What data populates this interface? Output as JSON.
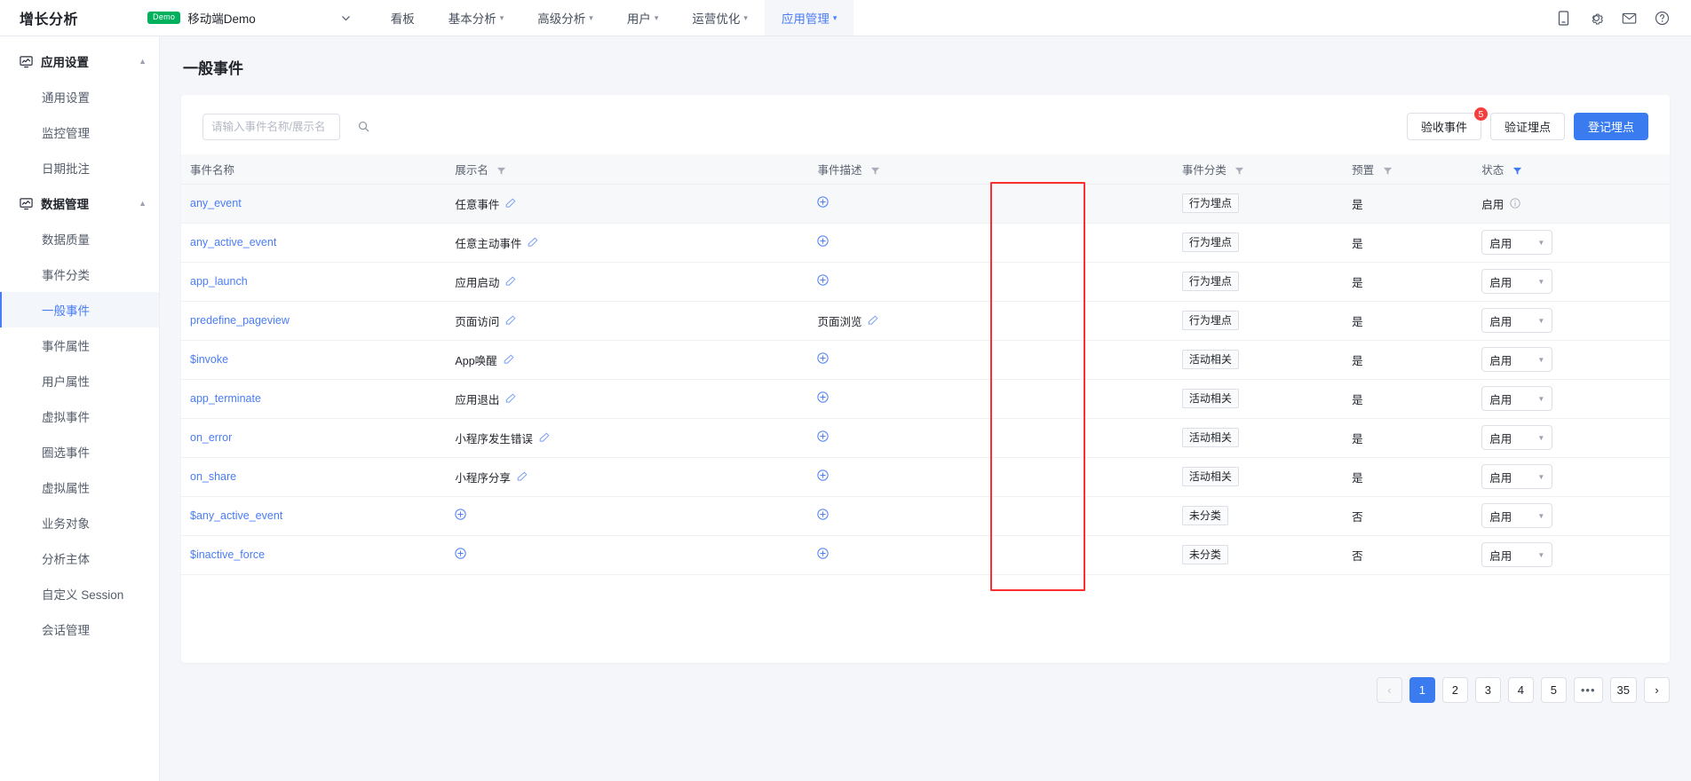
{
  "topbar": {
    "brand": "增长分析",
    "project": {
      "badge": "Demo",
      "name": "移动端Demo"
    },
    "nav": [
      {
        "label": "看板",
        "caret": false,
        "active": false
      },
      {
        "label": "基本分析",
        "caret": true,
        "active": false
      },
      {
        "label": "高级分析",
        "caret": true,
        "active": false
      },
      {
        "label": "用户",
        "caret": true,
        "active": false
      },
      {
        "label": "运营优化",
        "caret": true,
        "active": false
      },
      {
        "label": "应用管理",
        "caret": true,
        "active": true
      }
    ],
    "icons": [
      "mobile-icon",
      "gear-icon",
      "mail-icon",
      "help-icon"
    ]
  },
  "sidebar": {
    "groups": [
      {
        "label": "应用设置",
        "icon": "monitor-chart-icon",
        "expanded": true,
        "items": [
          {
            "label": "通用设置",
            "active": false
          },
          {
            "label": "监控管理",
            "active": false
          },
          {
            "label": "日期批注",
            "active": false
          }
        ]
      },
      {
        "label": "数据管理",
        "icon": "monitor-chart-icon",
        "expanded": true,
        "items": [
          {
            "label": "数据质量",
            "active": false
          },
          {
            "label": "事件分类",
            "active": false
          },
          {
            "label": "一般事件",
            "active": true
          },
          {
            "label": "事件属性",
            "active": false
          },
          {
            "label": "用户属性",
            "active": false
          },
          {
            "label": "虚拟事件",
            "active": false
          },
          {
            "label": "圈选事件",
            "active": false
          },
          {
            "label": "虚拟属性",
            "active": false
          },
          {
            "label": "业务对象",
            "active": false
          },
          {
            "label": "分析主体",
            "active": false
          },
          {
            "label": "自定义 Session",
            "active": false
          },
          {
            "label": "会话管理",
            "active": false
          }
        ]
      }
    ]
  },
  "page": {
    "title": "一般事件"
  },
  "search": {
    "value": "",
    "placeholder": "请输入事件名称/展示名"
  },
  "toolbar": {
    "accept_events_label": "验收事件",
    "accept_events_badge": "5",
    "verify_label": "验证埋点",
    "register_label": "登记埋点"
  },
  "table": {
    "columns": [
      {
        "label": "事件名称",
        "filter": false,
        "filter_active": false
      },
      {
        "label": "展示名",
        "filter": true,
        "filter_active": false
      },
      {
        "label": "事件描述",
        "filter": true,
        "filter_active": false
      },
      {
        "label": "事件分类",
        "filter": true,
        "filter_active": false
      },
      {
        "label": "预置",
        "filter": true,
        "filter_active": false
      },
      {
        "label": "状态",
        "filter": true,
        "filter_active": true
      }
    ],
    "rows": [
      {
        "name": "any_event",
        "display": "任意事件",
        "display_add": false,
        "desc": "",
        "desc_add": true,
        "category": "行为埋点",
        "preset": "是",
        "status": "启用",
        "status_is_select": false,
        "hovered": true
      },
      {
        "name": "any_active_event",
        "display": "任意主动事件",
        "display_add": false,
        "desc": "",
        "desc_add": true,
        "category": "行为埋点",
        "preset": "是",
        "status": "启用",
        "status_is_select": true,
        "hovered": false
      },
      {
        "name": "app_launch",
        "display": "应用启动",
        "display_add": false,
        "desc": "",
        "desc_add": true,
        "category": "行为埋点",
        "preset": "是",
        "status": "启用",
        "status_is_select": true,
        "hovered": false
      },
      {
        "name": "predefine_pageview",
        "display": "页面访问",
        "display_add": false,
        "desc": "页面浏览",
        "desc_add": false,
        "category": "行为埋点",
        "preset": "是",
        "status": "启用",
        "status_is_select": true,
        "hovered": false
      },
      {
        "name": "$invoke",
        "display": "App唤醒",
        "display_add": false,
        "desc": "",
        "desc_add": true,
        "category": "活动相关",
        "preset": "是",
        "status": "启用",
        "status_is_select": true,
        "hovered": false
      },
      {
        "name": "app_terminate",
        "display": "应用退出",
        "display_add": false,
        "desc": "",
        "desc_add": true,
        "category": "活动相关",
        "preset": "是",
        "status": "启用",
        "status_is_select": true,
        "hovered": false
      },
      {
        "name": "on_error",
        "display": "小程序发生错误",
        "display_add": false,
        "desc": "",
        "desc_add": true,
        "category": "活动相关",
        "preset": "是",
        "status": "启用",
        "status_is_select": true,
        "hovered": false
      },
      {
        "name": "on_share",
        "display": "小程序分享",
        "display_add": false,
        "desc": "",
        "desc_add": true,
        "category": "活动相关",
        "preset": "是",
        "status": "启用",
        "status_is_select": true,
        "hovered": false
      },
      {
        "name": "$any_active_event",
        "display": "",
        "display_add": true,
        "desc": "",
        "desc_add": true,
        "category": "未分类",
        "preset": "否",
        "status": "启用",
        "status_is_select": true,
        "hovered": false
      },
      {
        "name": "$inactive_force",
        "display": "",
        "display_add": true,
        "desc": "",
        "desc_add": true,
        "category": "未分类",
        "preset": "否",
        "status": "启用",
        "status_is_select": true,
        "hovered": false
      }
    ]
  },
  "pagination": {
    "prev": "‹",
    "next": "›",
    "pages": [
      "1",
      "2",
      "3",
      "4",
      "5",
      "•••",
      "35"
    ],
    "current": "1"
  },
  "annotation": {
    "color": "#fb2f2f",
    "target_column": "事件分类"
  }
}
